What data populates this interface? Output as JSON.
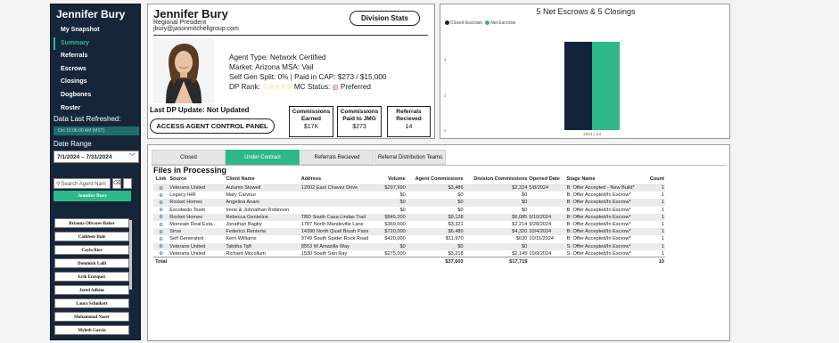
{
  "sidebar": {
    "agent_name": "Jennifer Bury",
    "nav": [
      {
        "label": "My Snapshot",
        "active": false
      },
      {
        "label": "Summary",
        "active": true
      },
      {
        "label": "Referrals",
        "active": false
      },
      {
        "label": "Escrows",
        "active": false
      },
      {
        "label": "Closings",
        "active": false
      },
      {
        "label": "Dogbones",
        "active": false
      },
      {
        "label": "Roster",
        "active": false
      }
    ],
    "refresh_label": "Data Last Refreshed:",
    "refresh_value": "Oct 10 06:00 AM (MST)",
    "date_range_label": "Date Range",
    "date_range_value": "7/1/2024 – 7/31/2024",
    "search_placeholder": "Search Agent Nam",
    "selected_agent": "Jennifer Bury",
    "agents": [
      "Brianna Olivares-Baker",
      "Cathleen Itule",
      "Cayla Rios",
      "Dominick Lalli",
      "Erik Enriquez",
      "Jared Adkins",
      "Laura Schnikert",
      "Mohammad Naser",
      "Myleth Garcia"
    ]
  },
  "profile": {
    "name": "Jennifer Bury",
    "title": "Regional President",
    "email": "jbury@jasonmitchellgroup.com",
    "division_stats_label": "Division Stats",
    "agent_type": "Agent Type: Network Certified",
    "market": "Market: Arizona MSA: Vail",
    "split": "Self Gen Split: 0% | Paid in CAP: $273 / $15,000",
    "dp_rank_label": "DP Rank:",
    "stars": "☆☆☆☆☆",
    "mc_status_label": "MC Status:",
    "mc_status_value": "Preferred",
    "last_dp_update": "Last DP Update: Not Updated",
    "access_panel_label": "ACCESS AGENT CONTROL PANEL",
    "boxes": [
      {
        "label": "Commissions Earned",
        "value": "$17K"
      },
      {
        "label": "Commissions Paid to JMG",
        "value": "$273"
      },
      {
        "label": "Referrals Recieved",
        "value": "14"
      }
    ]
  },
  "chart_data": {
    "type": "bar",
    "title": "5 Net Escrows & 5 Closings",
    "categories": [
      "2024 | Jul"
    ],
    "series": [
      {
        "name": "Closed Escrows",
        "values": [
          5
        ],
        "color": "#13233b"
      },
      {
        "name": "Net Escrows",
        "values": [
          5
        ],
        "color": "#2eb88a"
      }
    ],
    "yticks": [
      0,
      2,
      4
    ],
    "ylim": [
      0,
      5.6
    ],
    "legend": "top-left",
    "grid": false
  },
  "tabs": [
    {
      "label": "Closed",
      "active": false
    },
    {
      "label": "Under Contract",
      "active": true
    },
    {
      "label": "Referrals Recieved",
      "active": false
    },
    {
      "label": "Referral Distribution Teams",
      "active": false
    }
  ],
  "table": {
    "title": "Files in Processing",
    "columns": [
      "Link",
      "Source",
      "Client Name",
      "Address",
      "Volume",
      "Agent Commissions",
      "Division Commissions",
      "Opened Date",
      "Stage Name",
      "Count"
    ],
    "rows": [
      [
        "",
        "Veterans United",
        "Autumn Stowell",
        "12002 East Chavez Drive",
        "$297,990",
        "$3,486",
        "$2,324",
        "5/8/2024",
        "B: Offer Accepted - New Build*",
        "1"
      ],
      [
        "",
        "Legacy IHR",
        "Mary Carvour",
        "",
        "$0",
        "$0",
        "$0",
        "",
        "B: Offer Accepted/In Escrow*",
        "1"
      ],
      [
        "",
        "Rocket Homes",
        "Angelina Anani",
        "",
        "$0",
        "$0",
        "$0",
        "",
        "B: Offer Accepted/In Escrow*",
        "1"
      ],
      [
        "",
        "Escobedo Team",
        "Irene & Johnathan Robinson",
        "",
        "$0",
        "$0",
        "$0",
        "",
        "B: Offer Accepted/In Escrow*",
        "1"
      ],
      [
        "",
        "Rocket Homes",
        "Rebecca Genteline",
        "TBD South Casa Lindas Trail",
        "$845,200",
        "$9,128",
        "$6,085",
        "9/10/2024",
        "B: Offer Accepted/In Escrow*",
        "1"
      ],
      [
        "",
        "Morreale Real Esta...",
        "Jonathan Bagby",
        "1787 North Mandeville Lane",
        "$369,000",
        "$3,321",
        "$2,214",
        "9/28/2024",
        "B: Offer Accepted/In Escrow*",
        "1"
      ],
      [
        "",
        "Sirva",
        "Federico Renteria",
        "14390 North Quail Brush Pass",
        "$720,000",
        "$6,480",
        "$4,320",
        "10/4/2024",
        "B: Offer Accepted/In Escrow*",
        "1"
      ],
      [
        "",
        "Self Generated",
        "Kerri Williams",
        "9749 South Spider Rock Road",
        "$420,000",
        "$11,970",
        "$630",
        "10/11/2024",
        "B: Offer Accepted/In Escrow*",
        "1"
      ],
      [
        "",
        "Veterans United",
        "Tabitha Taft",
        "8553 W Amazilla Way",
        "$0",
        "$0",
        "$0",
        "",
        "S: Offer Accepted/In Escrow*",
        "1"
      ],
      [
        "",
        "Veterans United",
        "Richard Mccollum",
        "1530 South San Ray",
        "$275,000",
        "$3,218",
        "$2,145",
        "10/9/2024",
        "S: Offer Accepted/In Escrow*",
        "1"
      ]
    ],
    "total": [
      "Total",
      "",
      "",
      "",
      "",
      "$37,603",
      "$17,719",
      "",
      "",
      "10"
    ]
  }
}
